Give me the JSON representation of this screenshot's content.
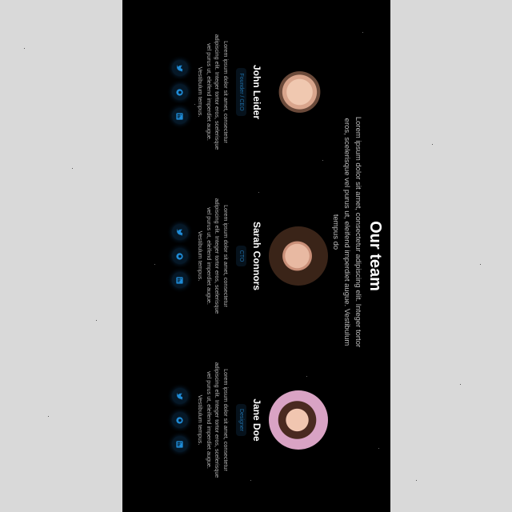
{
  "page": {
    "title": "Our team",
    "subtitle": "Lorem ipsum dolor sit amet, consectetur adipiscing elit. Integer tortor eros, scelerisque vel purus ut, eleifend imperdiet augue. Vestibulum tempus do"
  },
  "members": [
    {
      "name": "John Leider",
      "role": "Founder / CEO",
      "bio": "Lorem ipsum dolor sit amet, consectetur adipiscing elit. Integer tortor eros, scelerisque vel purus ut, eleifend imperdiet augue. Vestibulum tempus."
    },
    {
      "name": "Sarah Connors",
      "role": "CTO",
      "bio": "Lorem ipsum dolor sit amet, consectetur adipiscing elit. Integer tortor eros, scelerisque vel purus ut, eleifend imperdiet augue. Vestibulum tempus."
    },
    {
      "name": "Jane Doe",
      "role": "Designer",
      "bio": "Lorem ipsum dolor sit amet, consectetur adipiscing elit. Integer tortor eros, scelerisque vel purus ut, eleifend imperdiet augue. Vestibulum tempus."
    }
  ],
  "social_icons": [
    "twitter-icon",
    "github-icon",
    "linkedin-icon"
  ],
  "colors": {
    "background": "#000000",
    "accent": "#1f8bd6",
    "outer_background": "#d9d9d9"
  }
}
